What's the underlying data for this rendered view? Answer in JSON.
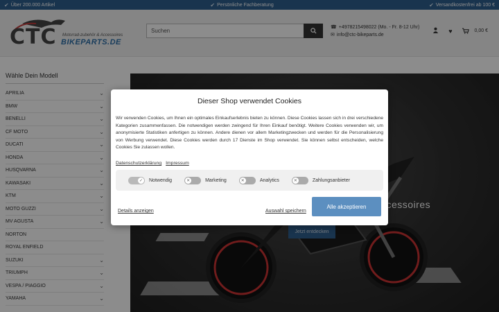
{
  "topbar": {
    "left": "Über 200.000 Artikel",
    "center": "Persönliche Fachberatung",
    "right": "Versandkostenfrei ab 100 €"
  },
  "logo": {
    "letters": "CTC",
    "tagline": "Motorrad-zubehör & Accessoires",
    "brand": "BIKEPARTS.DE"
  },
  "search": {
    "placeholder": "Suchen"
  },
  "contact": {
    "phone": "+4978215498022 (Mo. - Fr. 8-12 Uhr)",
    "email": "info@ctc-bikeparts.de"
  },
  "cart": {
    "total": "0,00 €"
  },
  "sidebar": {
    "title": "Wähle Dein Modell",
    "items": [
      {
        "label": "APRILIA",
        "has_children": true
      },
      {
        "label": "BMW",
        "has_children": true
      },
      {
        "label": "BENELLI",
        "has_children": true
      },
      {
        "label": "CF MOTO",
        "has_children": true
      },
      {
        "label": "DUCATI",
        "has_children": true
      },
      {
        "label": "HONDA",
        "has_children": true
      },
      {
        "label": "HUSQVARNA",
        "has_children": true
      },
      {
        "label": "KAWASAKI",
        "has_children": true
      },
      {
        "label": "KTM",
        "has_children": true
      },
      {
        "label": "MOTO GUZZI",
        "has_children": true
      },
      {
        "label": "MV AGUSTA",
        "has_children": true
      },
      {
        "label": "NORTON",
        "has_children": false
      },
      {
        "label": "ROYAL ENFIELD",
        "has_children": false
      },
      {
        "label": "SUZUKI",
        "has_children": true
      },
      {
        "label": "TRIUMPH",
        "has_children": true
      },
      {
        "label": "VESPA / PIAGGIO",
        "has_children": true
      },
      {
        "label": "YAMAHA",
        "has_children": true
      }
    ]
  },
  "hero": {
    "title": "ccessoires",
    "cta": "Jetzt entdecken"
  },
  "cookie": {
    "title": "Dieser Shop verwendet Cookies",
    "body": "Wir verwenden Cookies, um Ihnen ein optimales Einkaufserlebnis bieten zu können. Diese Cookies lassen sich in drei verschiedene Kategorien zusammenfassen. Die notwendigen werden zwingend für Ihren Einkauf benötigt. Weitere Cookies verwenden wir, um anonymisierte Statistiken anfertigen zu können. Andere dienen vor allem Marketingzwecken und werden für die Personalisierung von Werbung verwendet. Diese Cookies werden durch 17 Dienste im Shop verwendet. Sie können selbst entscheiden, welche Cookies Sie zulassen wollen.",
    "privacy_link": "Datenschutzerklärung",
    "imprint_link": "Impressum",
    "toggles": [
      {
        "label": "Notwendig",
        "on": true
      },
      {
        "label": "Marketing",
        "on": false
      },
      {
        "label": "Analytics",
        "on": false
      },
      {
        "label": "Zahlungsanbieter",
        "on": false
      }
    ],
    "details": "Details anzeigen",
    "save": "Auswahl speichern",
    "accept": "Alle akzeptieren"
  },
  "colors": {
    "topbar": "#2f5f8f",
    "accept": "#5c8fc0",
    "brand": "#2f6fa8"
  }
}
